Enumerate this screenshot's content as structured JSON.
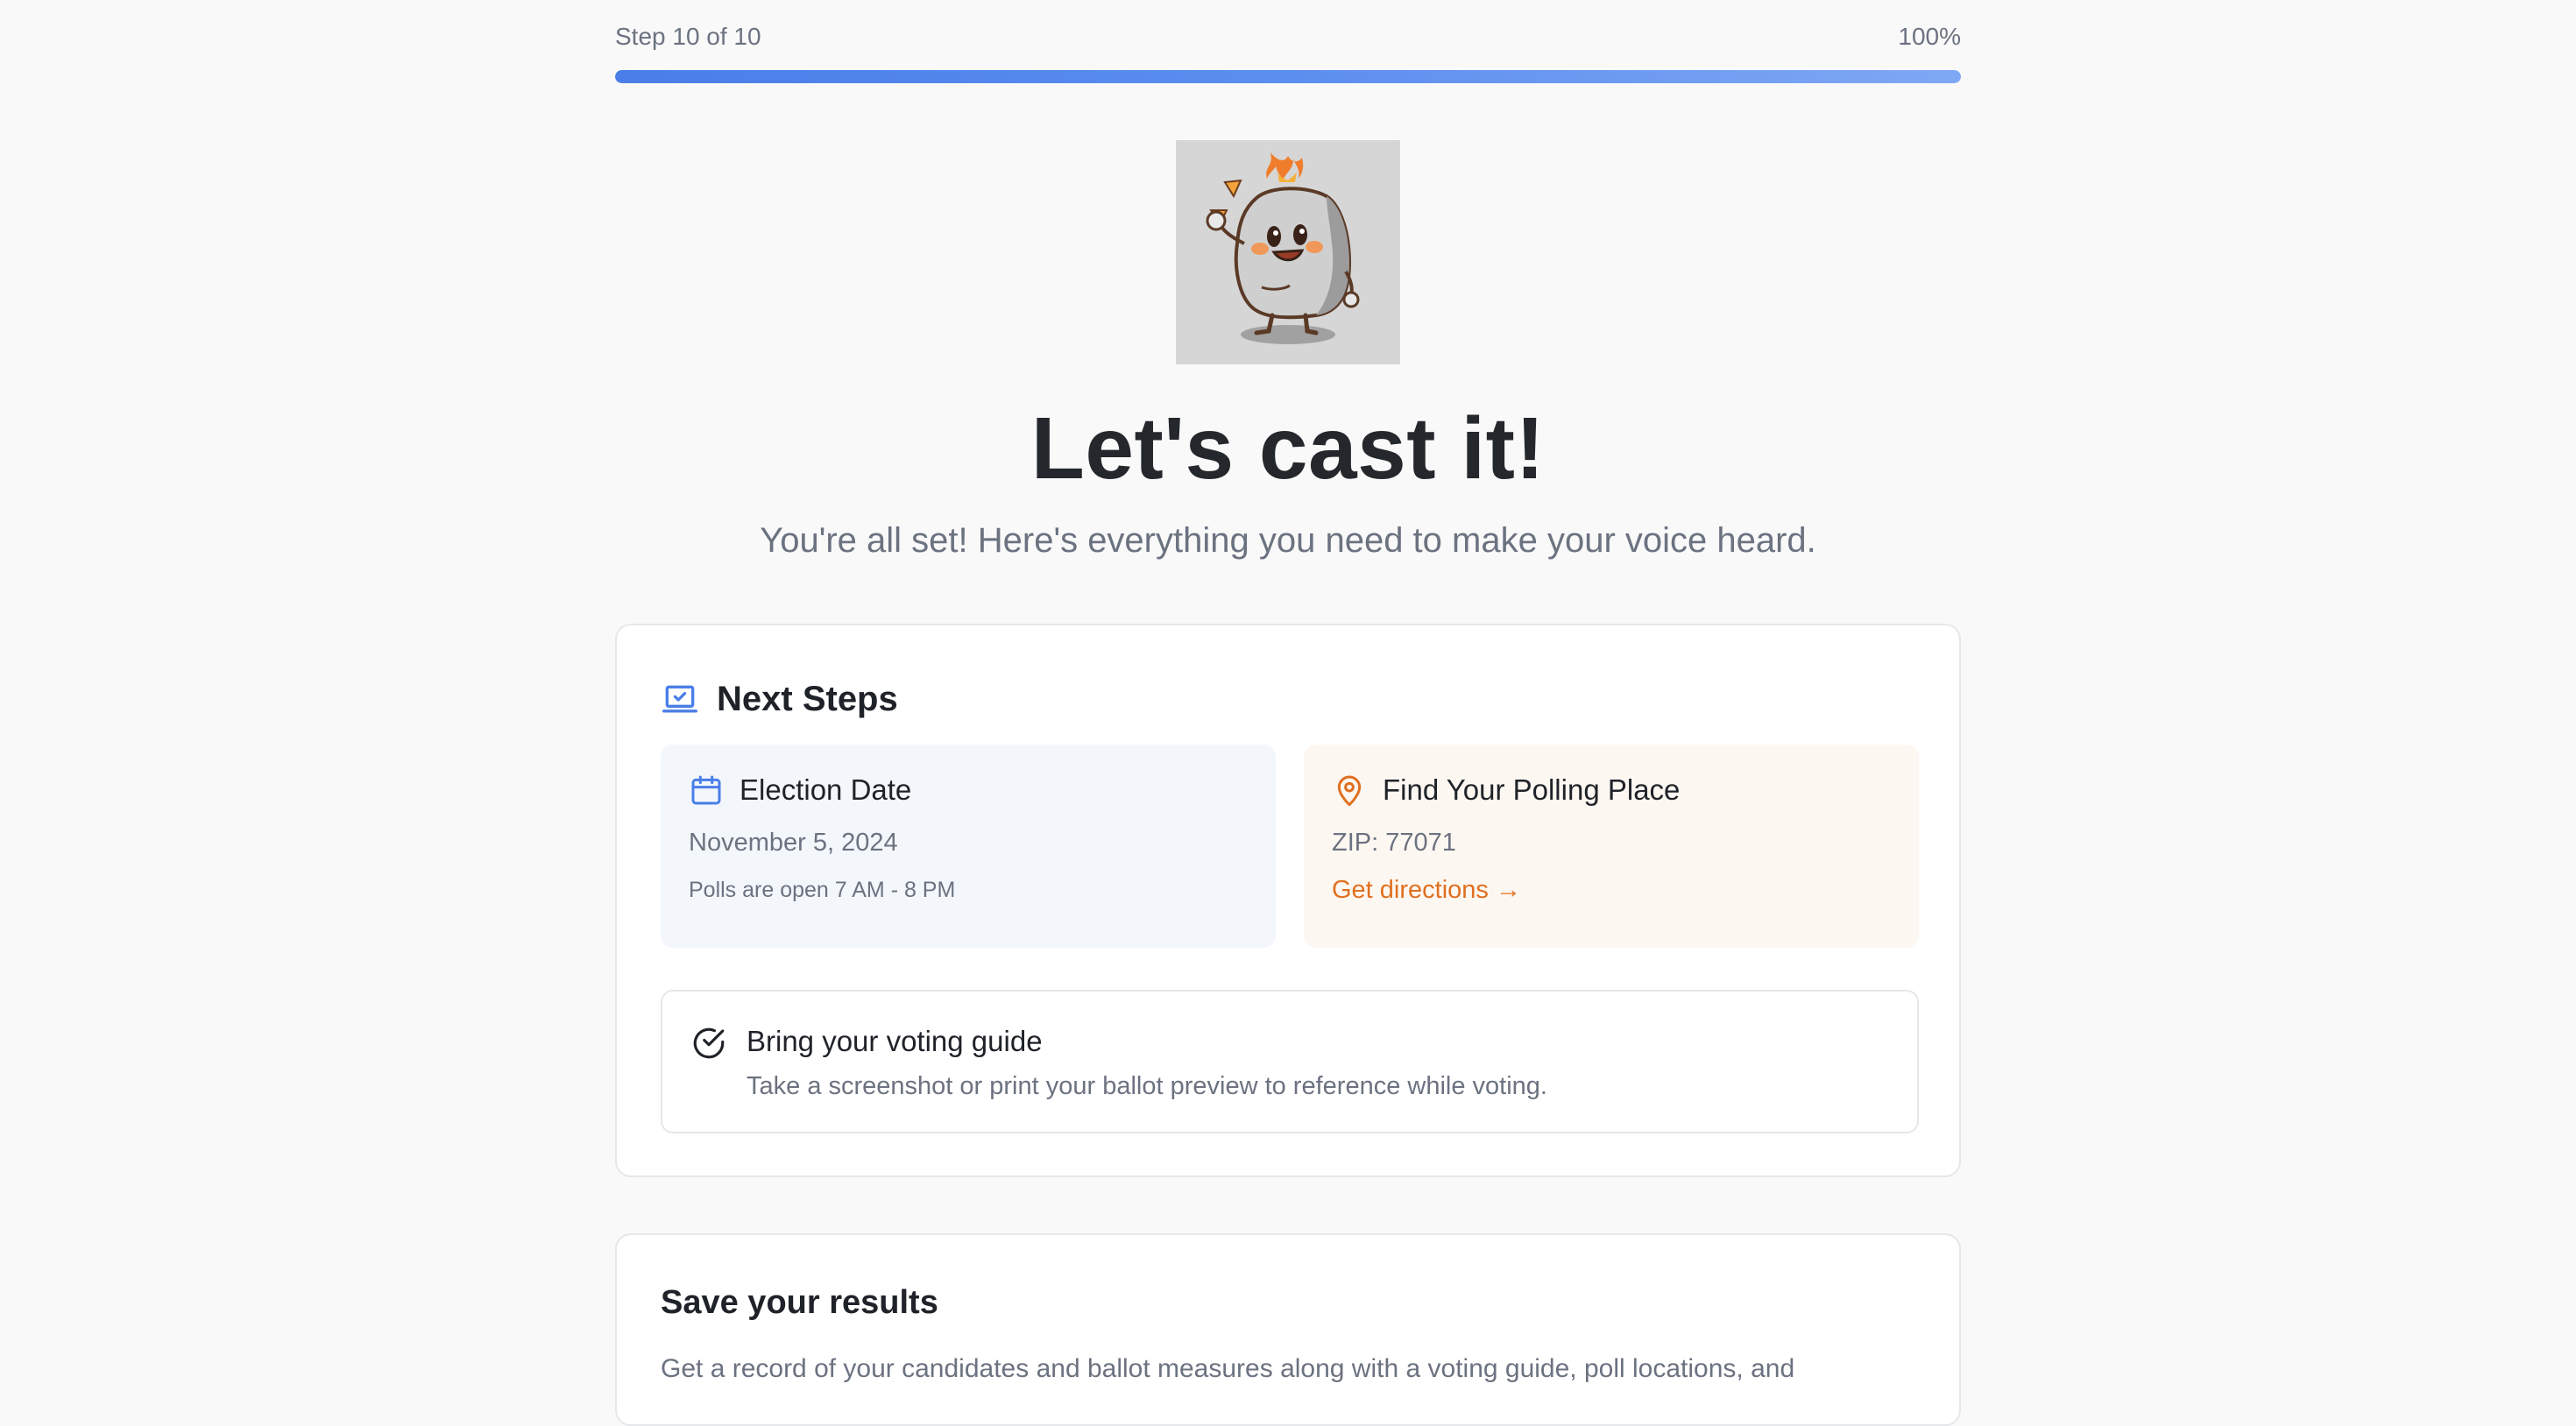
{
  "progress": {
    "step_label": "Step 10 of 10",
    "percent_label": "100%",
    "value": 1.0,
    "fill_color": "#4a7ee8"
  },
  "hero": {
    "mascot_icon": "rock-mascot-icon",
    "title": "Let's cast it!",
    "subtitle": "You're all set! Here's everything you need to make your voice heard."
  },
  "next_steps": {
    "icon": "laptop-check-icon",
    "title": "Next Steps",
    "election": {
      "icon": "calendar-icon",
      "title": "Election Date",
      "date": "November 5, 2024",
      "hours": "Polls are open 7 AM - 8 PM"
    },
    "polling": {
      "icon": "map-pin-icon",
      "title": "Find Your Polling Place",
      "zip": "ZIP: 77071",
      "link": "Get directions →"
    },
    "guide": {
      "icon": "check-circle-icon",
      "title": "Bring your voting guide",
      "description": "Take a screenshot or print your ballot preview to reference while voting."
    }
  },
  "save": {
    "title": "Save your results",
    "description": "Get a record of your candidates and ballot measures along with a voting guide, poll locations, and"
  },
  "colors": {
    "accent_blue": "#4a7ee8",
    "accent_orange": "#e07020",
    "text_dark": "#1f2329",
    "text_muted": "#6b7280"
  }
}
